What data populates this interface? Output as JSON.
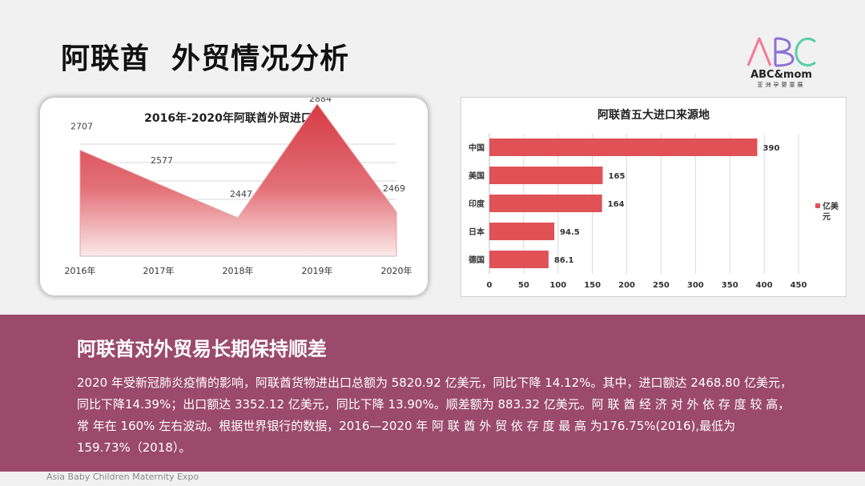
{
  "page": {
    "title": "阿联酋  外贸情况分析",
    "footer": "Asia Baby Children Maternity Expo"
  },
  "logo": {
    "letters": "ABC",
    "name": "ABC&mom",
    "sub": "亚洲孕婴童展"
  },
  "colors": {
    "accent_red": "#d63a44",
    "bar_red": "#e05256",
    "band": "#9b4a6b"
  },
  "band": {
    "title": "阿联酋对外贸易长期保持顺差",
    "body": "2020 年受新冠肺炎疫情的影响，阿联酋货物进出口总额为 5820.92 亿美元，同比下降 14.12%。其中，进口额达 2468.80 亿美元，同比下降14.39%；出口额达 3352.12 亿美元，同比下降 13.90%。顺差额为 883.32 亿美元。阿 联 酋 经 济 对 外 依 存 度 较 高， 常 年在 160% 左右波动。根据世界银行的数据，2016—2020 年 阿 联 酋 外 贸 依 存 度 最 高 为176.75%(2016),最低为 159.73%（2018）。"
  },
  "chart_data": [
    {
      "type": "area",
      "title": "2016年-2020年阿联酋外贸进口额",
      "categories": [
        "2016年",
        "2017年",
        "2018年",
        "2019年",
        "2020年"
      ],
      "values": [
        2707,
        2577,
        2447,
        2884,
        2469
      ],
      "grid": true
    },
    {
      "type": "bar",
      "orientation": "horizontal",
      "title": "阿联酋五大进口来源地",
      "categories": [
        "中国",
        "美国",
        "印度",
        "日本",
        "德国"
      ],
      "values": [
        390,
        165,
        164,
        94.5,
        86.1
      ],
      "xlim": [
        0,
        450
      ],
      "xticks": [
        0,
        50,
        100,
        150,
        200,
        250,
        300,
        350,
        400,
        450
      ],
      "legend": "亿美元",
      "legend_position": "right",
      "grid": true
    }
  ]
}
